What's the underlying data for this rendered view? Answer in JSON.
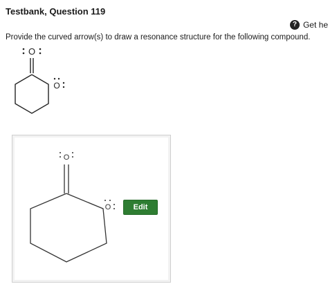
{
  "header": {
    "title": "Testbank, Question 119",
    "help_label": "Get he"
  },
  "question": {
    "text": "Provide the curved arrow(s) to draw a resonance structure for the following compound."
  },
  "molecule": {
    "carbonyl_oxygen_label": "O",
    "ring_oxygen_label": "O"
  },
  "drawing_panel": {
    "edit_label": "Edit"
  },
  "colors": {
    "edit_button": "#2e7d32",
    "help_icon": "#222222"
  },
  "icons": {
    "help": "question-circle-icon"
  }
}
